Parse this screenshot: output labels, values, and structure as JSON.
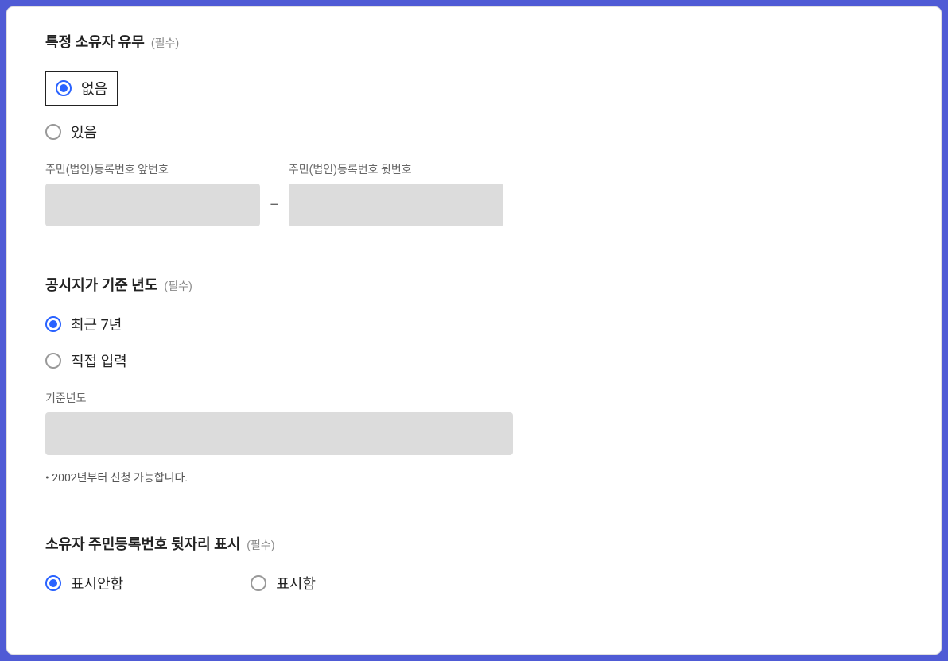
{
  "sections": {
    "specificOwner": {
      "title": "특정 소유자 유무",
      "required": "(필수)",
      "options": {
        "none": "없음",
        "exists": "있음"
      },
      "inputs": {
        "frontLabel": "주민(법인)등록번호 앞번호",
        "backLabel": "주민(법인)등록번호 뒷번호"
      }
    },
    "priceYear": {
      "title": "공시지가 기준 년도",
      "required": "(필수)",
      "options": {
        "recent7": "최근 7년",
        "direct": "직접 입력"
      },
      "inputLabel": "기준년도",
      "helper": "2002년부터 신청 가능합니다."
    },
    "ownerIdDisplay": {
      "title": "소유자 주민등록번호 뒷자리 표시",
      "required": "(필수)",
      "options": {
        "hide": "표시안함",
        "show": "표시함"
      }
    }
  }
}
